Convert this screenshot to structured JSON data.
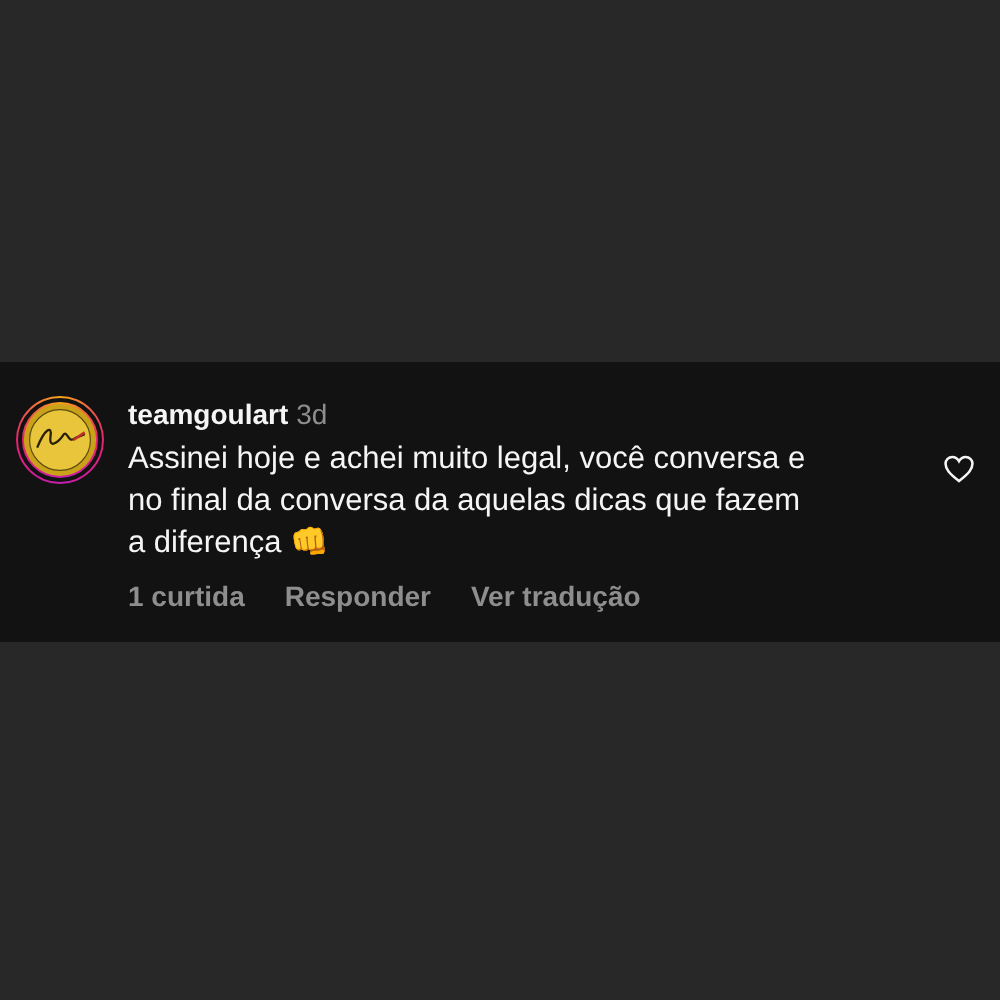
{
  "comment": {
    "username": "teamgoulart",
    "time": "3d",
    "text": "Assinei hoje e achei muito legal, você conversa e no final da conversa da aquelas dicas que fazem a diferença 👊",
    "liked": false,
    "actions": [
      "1 curtida",
      "Responder",
      "Ver tradução"
    ]
  }
}
